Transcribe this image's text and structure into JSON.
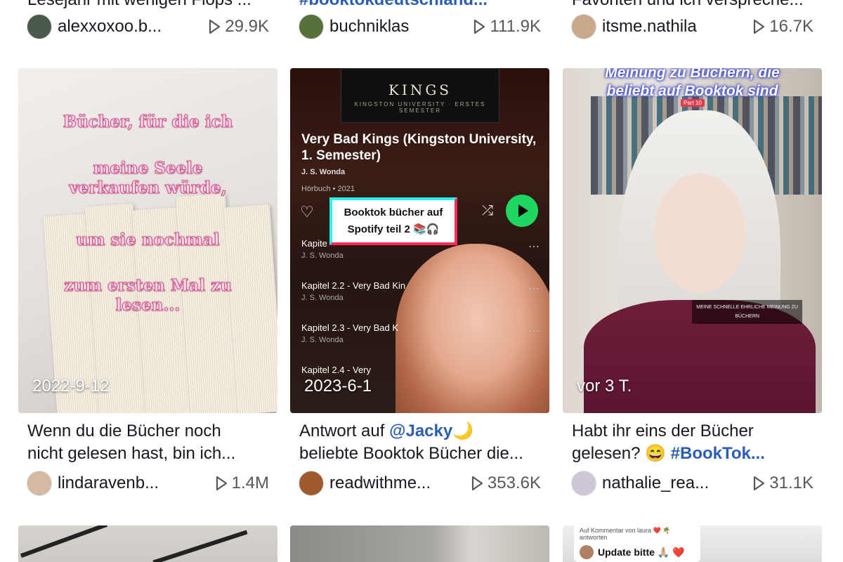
{
  "top_row": [
    {
      "caption": "Lesejahr mit wenigen Flops ...",
      "username": "alexxoxoo.b...",
      "views": "29.9K",
      "avatar_color": "#4a5a4c"
    },
    {
      "caption": "#booktokdeutschland...",
      "username": "buchniklas",
      "views": "111.9K",
      "avatar_color": "#58703a"
    },
    {
      "caption": "Favoriten und ich verspreche...",
      "username": "itsme.nathila",
      "views": "16.7K",
      "avatar_color": "#c9a98c"
    }
  ],
  "cards": [
    {
      "date": "2022-9-12",
      "overlay_lines": [
        "Bücher, für die ich",
        "meine Seele",
        "verkaufen würde,",
        "um sie nochmal",
        "zum ersten Mal zu",
        "lesen..."
      ],
      "caption_line1": "Wenn du die Bücher noch",
      "caption_line2": "nicht gelesen hast, bin ich...",
      "username": "lindaravenb...",
      "views": "1.4M",
      "avatar_color": "#d6b9a5"
    },
    {
      "date": "2023-6-1",
      "cover_title": "KINGS",
      "cover_sub": "KINGSTON UNIVERSITY · ERSTES SEMESTER",
      "book_title": "Very Bad Kings (Kingston University, 1. Semester)",
      "book_author": "J. S. Wonda",
      "book_meta": "Hörbuch • 2021",
      "sticker": "Booktok bücher auf Spotify teil 2 📚🎧",
      "tracks": [
        {
          "title": "Kapite",
          "author": "J. S. Wonda"
        },
        {
          "title": "Kapitel 2.2 - Very Bad Kin",
          "author": "J. S. Wonda"
        },
        {
          "title": "Kapitel 2.3 - Very Bad K",
          "author": "J. S. Wonda"
        },
        {
          "title": "Kapitel 2.4 - Very",
          "author": ""
        }
      ],
      "caption_prefix": "Antwort auf ",
      "caption_mention": "@Jacky",
      "caption_emoji": "🌙",
      "caption_line2": "beliebte Booktok Bücher die...",
      "username": "readwithme...",
      "views": "353.6K",
      "avatar_color": "#a0582e"
    },
    {
      "date": "vor 3 T.",
      "header_lines": [
        "Meinung zu Büchern, die",
        "beliebt auf Booktok sind"
      ],
      "part": "Part 10",
      "subtitle_lines": [
        "MEINE SCHNELLE EHRLICHE MEINUNG ZU",
        "BÜCHERN"
      ],
      "caption_line1": "Habt ihr eins der Bücher",
      "caption_line2_text": "gelesen? 😄 ",
      "caption_hashtag": "#BookTok...",
      "username": "nathalie_rea...",
      "views": "31.1K",
      "avatar_color": "#cfc7d6"
    }
  ],
  "bottom_row": [
    {},
    {},
    {
      "reply_label": "Auf Kommentar von laura ❤️ 🌴 antworten",
      "comment": "Update bitte 🙏🏼 ❤️"
    }
  ]
}
